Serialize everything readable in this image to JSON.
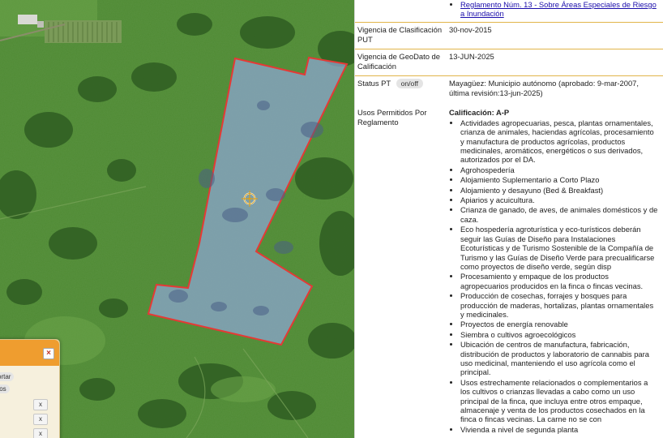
{
  "info": {
    "link_regulation": "Reglamento Núm. 13 - Sobre Áreas Especiales de Riesgo a Inundación",
    "vigencia_put_label": "Vigencia de Clasificación PUT",
    "vigencia_put_value": "30-nov-2015",
    "vigencia_geo_label": "Vigencia de GeoDato de Calificación",
    "vigencia_geo_value": "13-JUN-2025",
    "status_label": "Status PT",
    "status_toggle": "on/off",
    "status_value": "Mayagüez: Municipio autónomo (aprobado: 9-mar-2007, última revisión:13-jun-2025)",
    "usos_label": "Usos Permitidos Por Reglamento",
    "calificacion": "Calificación: A-P",
    "usos": [
      "Actividades agropecuarias, pesca, plantas ornamentales, crianza de animales, haciendas agrícolas, procesamiento y manufactura de productos agrícolas, productos medicinales, aromáticos, energéticos o sus derivados, autorizados por el DA.",
      "Agrohospedería",
      "Alojamiento Suplementario a Corto Plazo",
      "Alojamiento y desayuno (Bed & Breakfast)",
      "Apiarios y acuicultura.",
      "Crianza de ganado, de aves, de animales domésticos y de caza.",
      "Eco hospedería agroturística y eco-turísticos deberán seguir las Guías de Diseño para Instalaciones Ecoturísticas y de Turismo Sostenible de la Compañía de Turismo y las Guías de Diseño Verde para precualificarse como proyectos de diseño verde, según disp",
      "Procesamiento y empaque de los productos agropecuarios producidos en la finca o fincas vecinas.",
      "Producción de cosechas, forrajes y bosques para producción de maderas, hortalizas, plantas ornamentales y medicinales.",
      "Proyectos de energía renovable",
      "Siembra o cultivos agroecológicos",
      "Ubicación de centros de manufactura, fabricación, distribución de productos y laboratorio de cannabis para uso medicinal, manteniendo el uso agrícola como el principal.",
      "Usos estrechamente relacionados o complementarios a los cultivos o crianzas llevadas a cabo como un uso principal de la finca, que incluya entre otros empaque, almacenaje y venta de los productos cosechados en la finca o fincas vecinas. La carne no se con",
      "Vivienda a nivel de segunda planta"
    ]
  },
  "popup": {
    "btn_1": "ortar",
    "btn_2": "tos",
    "close_symbol": "×",
    "x_symbol": "x"
  },
  "colors": {
    "parcel_outline": "#e53935",
    "parcel_fill": "#8ea6d6",
    "popup_header": "#ef9d2f",
    "link": "#1a0dab",
    "divider": "#e1b54a"
  }
}
